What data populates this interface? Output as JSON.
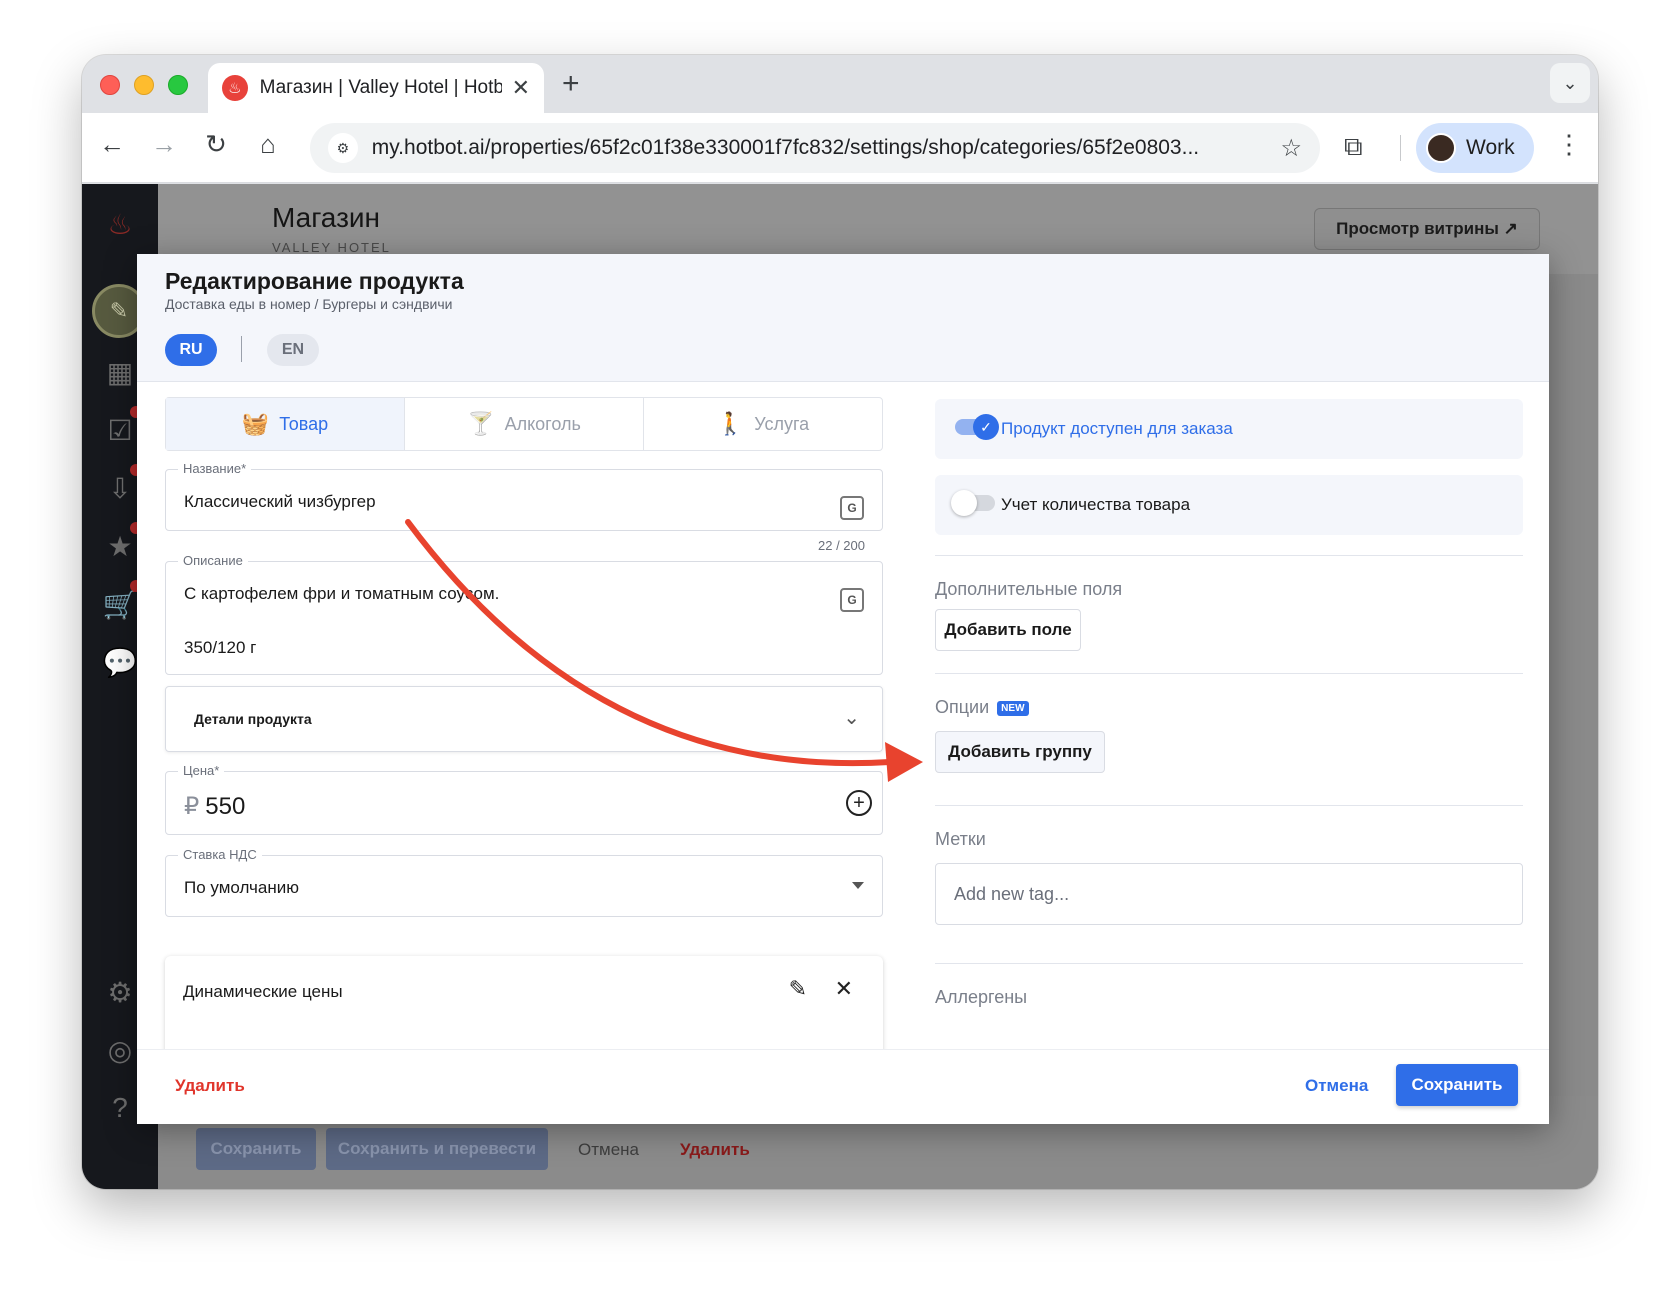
{
  "browser": {
    "tab_title": "Магазин | Valley Hotel | Hotbot",
    "new_tab_symbol": "+",
    "url": "my.hotbot.ai/properties/65f2c01f38e330001f7fc832/settings/shop/categories/65f2e0803...",
    "profile_label": "Work"
  },
  "background_page": {
    "title": "Магазин",
    "subtitle": "VALLEY HOTEL",
    "view_store_button": "Просмотр витрины ↗",
    "footer": {
      "save": "Сохранить",
      "save_translate": "Сохранить и перевести",
      "cancel": "Отмена",
      "delete": "Удалить"
    }
  },
  "modal": {
    "title": "Редактирование продукта",
    "breadcrumb": "Доставка еды в номер / Бургеры и сэндвичи",
    "languages": {
      "active": "RU",
      "other": "EN"
    },
    "type_tabs": [
      {
        "label": "Товар",
        "icon": "basket-icon",
        "active": true
      },
      {
        "label": "Алкоголь",
        "icon": "cocktail-icon",
        "active": false
      },
      {
        "label": "Услуга",
        "icon": "person-service-icon",
        "active": false
      }
    ],
    "name_field": {
      "label": "Название*",
      "value": "Классический чизбургер",
      "counter": "22 / 200"
    },
    "description_field": {
      "label": "Описание",
      "line1": "С картофелем фри и томатным соусом.",
      "line2": "350/120 г"
    },
    "details": {
      "label": "Детали продукта"
    },
    "price_field": {
      "label": "Цена*",
      "currency": "₽",
      "value": "550"
    },
    "vat_field": {
      "label": "Ставка НДС",
      "value": "По умолчанию"
    },
    "dynamic_prices": {
      "label": "Динамические цены"
    },
    "right": {
      "available_toggle": {
        "label": "Продукт доступен для заказа",
        "on": true
      },
      "stock_toggle": {
        "label": "Учет количества товара",
        "on": false
      },
      "extra_fields_title": "Дополнительные поля",
      "add_field_button": "Добавить поле",
      "options_title": "Опции",
      "new_badge": "NEW",
      "add_group_button": "Добавить группу",
      "tags_title": "Метки",
      "tags_placeholder": "Add new tag...",
      "allergens_title": "Аллергены"
    },
    "footer": {
      "delete": "Удалить",
      "cancel": "Отмена",
      "save": "Сохранить"
    }
  },
  "colors": {
    "accent": "#2f6ee8",
    "danger": "#e0352b",
    "annotation_arrow": "#e8432e"
  }
}
